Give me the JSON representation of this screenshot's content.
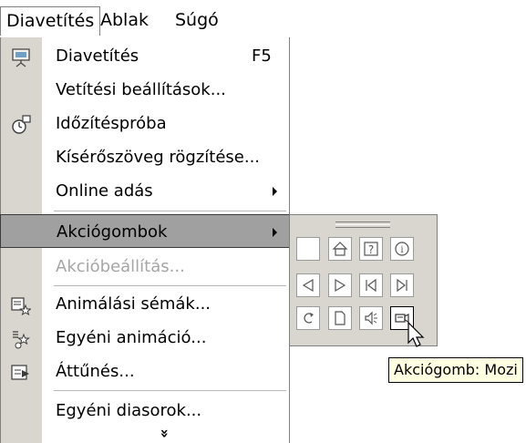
{
  "menubar": {
    "items": [
      {
        "label": "Diavetítés"
      },
      {
        "label": "Ablak"
      },
      {
        "label": "Súgó"
      }
    ]
  },
  "menu": {
    "items": [
      {
        "label": "Diavetítés",
        "shortcut": "F5",
        "icon": "slideshow-icon"
      },
      {
        "label": "Vetítési beállítások...",
        "icon": ""
      },
      {
        "label": "Időzítéspróba",
        "icon": "rehearse-timings-icon"
      },
      {
        "label": "Kísérőszöveg rögzítése...",
        "icon": ""
      },
      {
        "label": "Online adás",
        "icon": "",
        "submenu": true
      },
      {
        "label": "Akciógombok",
        "icon": "",
        "submenu": true,
        "highlighted": true
      },
      {
        "label": "Akcióbeállítás...",
        "icon": "",
        "disabled": true
      },
      {
        "label": "Animálási sémák...",
        "icon": "animation-schemes-icon"
      },
      {
        "label": "Egyéni animáció...",
        "icon": "custom-animation-icon"
      },
      {
        "label": "Áttűnés...",
        "icon": "slide-transition-icon"
      },
      {
        "label": "Egyéni diasorok...",
        "icon": ""
      }
    ],
    "more_glyph": "»"
  },
  "palette": {
    "buttons": [
      [
        "custom",
        "home",
        "help",
        "information"
      ],
      [
        "back",
        "forward",
        "beginning",
        "end"
      ],
      [
        "return",
        "document",
        "sound",
        "movie"
      ]
    ],
    "active": "movie"
  },
  "tooltip": {
    "text": "Akciógomb: Mozi"
  }
}
